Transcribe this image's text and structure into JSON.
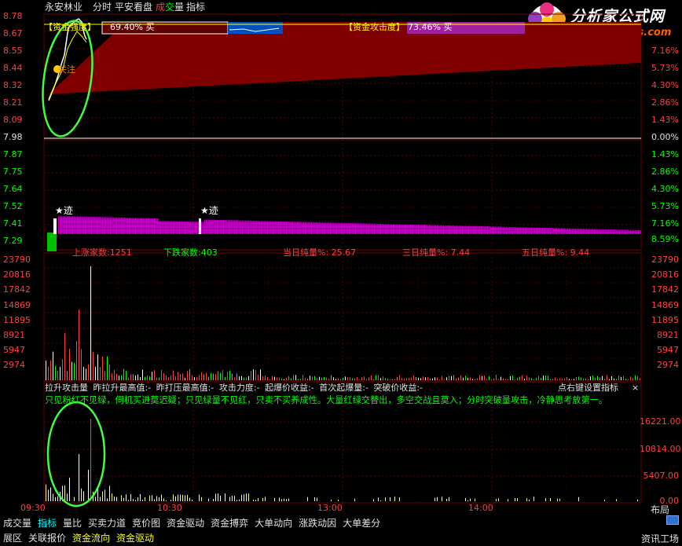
{
  "header": {
    "stock_name": "永安林业",
    "menu": [
      "分时",
      "平安看盘"
    ],
    "volume_label_a": "成",
    "volume_label_b": "交",
    "volume_label_c": "量",
    "indicator_label": "指标"
  },
  "logo": {
    "title": "分析家公式网",
    "url": "www.88gs.com"
  },
  "price_panel": {
    "left_axis": [
      "8.78",
      "8.67",
      "8.55",
      "8.44",
      "8.32",
      "8.21",
      "8.09",
      "7.98",
      "7.87",
      "7.75",
      "7.64",
      "7.52",
      "7.41",
      "7.29"
    ],
    "right_axis": [
      "7.16%",
      "5.73%",
      "4.30%",
      "2.86%",
      "1.43%",
      "0.00%",
      "1.43%",
      "2.86%",
      "4.30%",
      "5.73%",
      "7.16%",
      "8.59%"
    ],
    "fund_strength_label": "【资金强度】",
    "fund_strength_value": "69.40% 买",
    "fund_attack_label": "【资金攻击度】",
    "fund_attack_value": "73.46% 买",
    "focus_label": "关注",
    "marker_1": "★迹",
    "marker_2": "★迹",
    "rise_count": "上涨家数:1251",
    "fall_count": "下跌家数:403",
    "day_net": "当日纯量%: 25.67",
    "three_day_net": "三日纯量%: 7.44",
    "five_day_net": "五日纯量%: 9.44"
  },
  "volume_panel": {
    "left_axis": [
      "23790",
      "20816",
      "17842",
      "14869",
      "11895",
      "8921",
      "5947",
      "2974"
    ],
    "right_axis": [
      "23790",
      "20816",
      "17842",
      "14869",
      "11895",
      "8921",
      "5947",
      "2974"
    ]
  },
  "indicator_panel": {
    "title_items": [
      "拉升攻击量",
      "昨拉升最高值:-",
      "昨打压最高值:-",
      "攻击力度:-",
      "起爆价收益:-",
      "首次起爆量:-",
      "突破价收益:-"
    ],
    "settings_hint": "点右键设置指标",
    "close_symbol": "×",
    "tip_text": "只见粉红不见绿，伺机买进莫迟疑；只见绿量不见红，只卖不买养成性。大量红绿交替出，多空交战且莫入；分时突破量攻击，冷静思考放第一。",
    "right_axis": [
      "16221.00",
      "10814.00",
      "5407.00",
      "0.00"
    ]
  },
  "time_axis": [
    "09:30",
    "10:30",
    "13:00",
    "14:00"
  ],
  "layout_label": "布局",
  "tabs_row1": [
    "成交量",
    "指标",
    "量比",
    "买卖力道",
    "竞价图",
    "资金驱动",
    "资金搏弈",
    "大单动向",
    "涨跌动因",
    "大单差分"
  ],
  "tabs_row1_active": "指标",
  "tabs_row2": [
    "展区",
    "关联报价",
    "资金流向",
    "资金驱动"
  ],
  "tabs_row2_right": "资讯工场",
  "colors": {
    "axis_red": "#ff4040",
    "axis_green": "#00ff00",
    "grid": "#6b0000",
    "magenta": "#c000c0",
    "dark_red_fill": "#800000"
  }
}
